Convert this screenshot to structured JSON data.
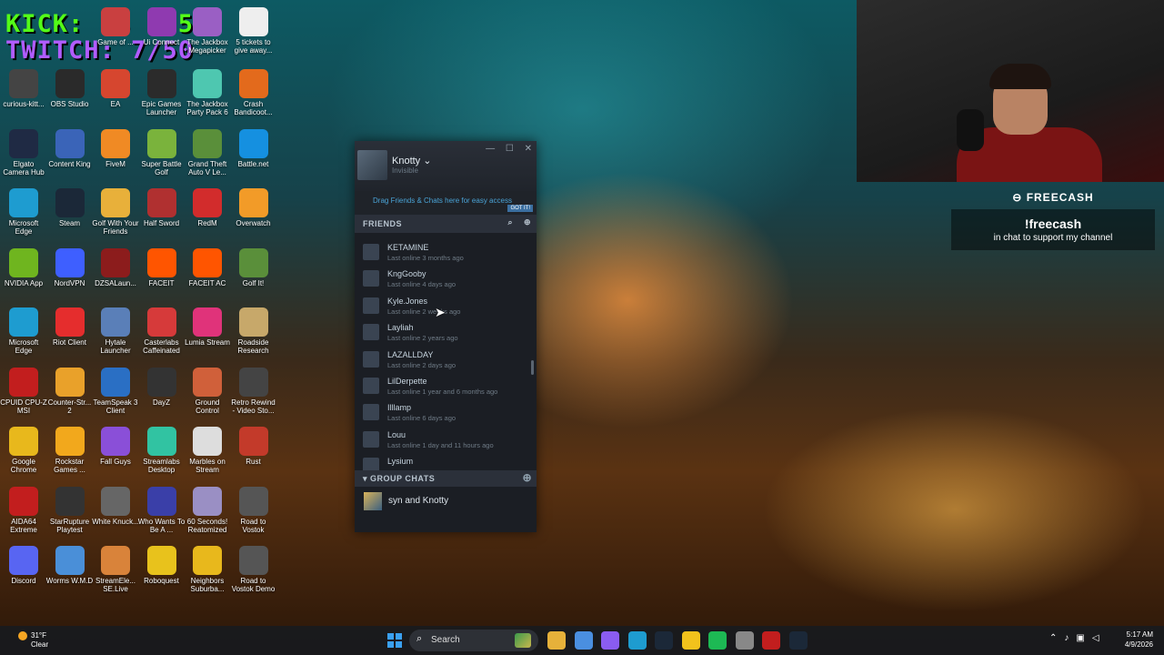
{
  "overlay": {
    "kick_counter": "KICK: 28 / 50",
    "twitch_counter": "TWITCH: 7/50",
    "freecash_brand": "FREECASH",
    "freecash_command": "!freecash",
    "freecash_tagline": "in chat to support my channel"
  },
  "desktop_icons": [
    {
      "label": "curious-kitt...",
      "color": "#444"
    },
    {
      "label": "OBS Studio",
      "color": "#2a2a2a"
    },
    {
      "label": "EA",
      "color": "#d6462f"
    },
    {
      "label": "Epic Games Launcher",
      "color": "#2b2b2b"
    },
    {
      "label": "The Jackbox Party Pack 6",
      "color": "#4ec7b0"
    },
    {
      "label": "Crash Bandicoot...",
      "color": "#e36a1c"
    },
    {
      "label": "Elgato Camera Hub",
      "color": "#1f2a44"
    },
    {
      "label": "Content King",
      "color": "#3a64b8"
    },
    {
      "label": "FiveM",
      "color": "#f08a24"
    },
    {
      "label": "Super Battle Golf",
      "color": "#7ab33c"
    },
    {
      "label": "Grand Theft Auto V Le...",
      "color": "#5a8f3a"
    },
    {
      "label": "Battle.net",
      "color": "#1590e0"
    },
    {
      "label": "Microsoft Edge",
      "color": "#1e9cd0"
    },
    {
      "label": "Steam",
      "color": "#1b2838"
    },
    {
      "label": "Golf With Your Friends",
      "color": "#e8b03a"
    },
    {
      "label": "Half Sword",
      "color": "#b03030"
    },
    {
      "label": "RedM",
      "color": "#d22c2c"
    },
    {
      "label": "Overwatch",
      "color": "#f29b28"
    },
    {
      "label": "NVIDIA App",
      "color": "#6fb51f"
    },
    {
      "label": "NordVPN",
      "color": "#3e5fff"
    },
    {
      "label": "DZSALaun...",
      "color": "#8c1c1c"
    },
    {
      "label": "FACEIT",
      "color": "#ff5500"
    },
    {
      "label": "FACEIT AC",
      "color": "#ff5500"
    },
    {
      "label": "Golf It!",
      "color": "#5a8f3a"
    },
    {
      "label": "Microsoft Edge",
      "color": "#1e9cd0"
    },
    {
      "label": "Riot Client",
      "color": "#e52d2d"
    },
    {
      "label": "Hytale Launcher",
      "color": "#5a7fb8"
    },
    {
      "label": "Casterlabs Caffeinated",
      "color": "#d63a3a"
    },
    {
      "label": "Lumia Stream",
      "color": "#e0337a"
    },
    {
      "label": "Roadside Research",
      "color": "#c7a86a"
    },
    {
      "label": "CPUID CPU-Z MSI",
      "color": "#c21e1e"
    },
    {
      "label": "Counter-Str... 2",
      "color": "#e9a12a"
    },
    {
      "label": "TeamSpeak 3 Client",
      "color": "#2a6fc4"
    },
    {
      "label": "DayZ",
      "color": "#333333"
    },
    {
      "label": "Ground Control",
      "color": "#d0603a"
    },
    {
      "label": "Retro Rewind - Video Sto...",
      "color": "#444444"
    },
    {
      "label": "Google Chrome",
      "color": "#e8b81c"
    },
    {
      "label": "Rockstar Games ...",
      "color": "#f2a81c"
    },
    {
      "label": "Fall Guys",
      "color": "#8a4fd8"
    },
    {
      "label": "Streamlabs Desktop",
      "color": "#31c3a2"
    },
    {
      "label": "Marbles on Stream",
      "color": "#dddddd"
    },
    {
      "label": "Rust",
      "color": "#c33a2a"
    },
    {
      "label": "AIDA64 Extreme",
      "color": "#c21e1e"
    },
    {
      "label": "StarRupture Playtest",
      "color": "#333333"
    },
    {
      "label": "White Knuck...",
      "color": "#666666"
    },
    {
      "label": "Who Wants To Be A ...",
      "color": "#3a3fa8"
    },
    {
      "label": "60 Seconds! Reatomized",
      "color": "#9a8fc4"
    },
    {
      "label": "Road to Vostok",
      "color": "#555555"
    },
    {
      "label": "Discord",
      "color": "#5865f2"
    },
    {
      "label": "Worms W.M.D",
      "color": "#4a8fd8"
    },
    {
      "label": "StreamEle... SE.Live",
      "color": "#d9833a"
    },
    {
      "label": "Roboquest",
      "color": "#e8c21c"
    },
    {
      "label": "Neighbors Suburba...",
      "color": "#e8b81c"
    },
    {
      "label": "Road to Vostok Demo",
      "color": "#555555"
    }
  ],
  "top_icons": [
    {
      "label": "Game of ...",
      "color": "#c94040"
    },
    {
      "label": "Ui Connect",
      "color": "#8f3ab0"
    },
    {
      "label": "The Jackbox Megapicker",
      "color": "#9a5fc4"
    },
    {
      "label": "5 tickets to give away...",
      "color": "#eeeeee"
    }
  ],
  "steam": {
    "user_name": "Knotty",
    "user_status": "Invisible",
    "window_min": "—",
    "window_max": "☐",
    "window_close": "✕",
    "drag_hint": "Drag Friends & Chats here for easy access",
    "got_it": "GOT IT!",
    "friends_header": "FRIENDS",
    "friends": [
      {
        "name": "KETAMINE",
        "status": "Last online 3 months ago"
      },
      {
        "name": "KngGooby",
        "status": "Last online 4 days ago"
      },
      {
        "name": "Kyle.Jones",
        "status": "Last online 2 weeks ago"
      },
      {
        "name": "Layliah",
        "status": "Last online 2 years ago"
      },
      {
        "name": "LAZALLDAY",
        "status": "Last online 2 days ago"
      },
      {
        "name": "LilDerpette",
        "status": "Last online 1 year and 6 months ago"
      },
      {
        "name": "Illlamp",
        "status": "Last online 6 days ago"
      },
      {
        "name": "Louu",
        "status": "Last online 1 day and 11 hours ago"
      },
      {
        "name": "Lysium",
        "status": ""
      }
    ],
    "group_chats_header": "GROUP CHATS",
    "group_chats": [
      {
        "name": "syn and Knotty"
      }
    ]
  },
  "taskbar": {
    "temperature": "31°F",
    "weather": "Clear",
    "search_placeholder": "Search",
    "time": "5:17 AM",
    "date": "4/9/2026",
    "apps": [
      "#e6b13a",
      "#4a8fe0",
      "#8a5cf0",
      "#1e9cd0",
      "#1b2838",
      "#f2c21c",
      "#1db954",
      "#888888",
      "#c21e1e",
      "#1b2838"
    ]
  }
}
